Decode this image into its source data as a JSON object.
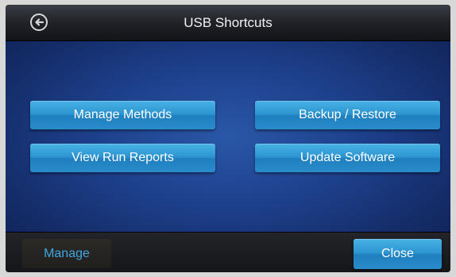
{
  "header": {
    "title": "USB Shortcuts",
    "back_icon": "back-arrow-circle-icon"
  },
  "main": {
    "buttons": [
      {
        "label": "Manage Methods"
      },
      {
        "label": "Backup / Restore"
      },
      {
        "label": "View Run Reports"
      },
      {
        "label": "Update Software"
      }
    ]
  },
  "footer": {
    "manage_label": "Manage",
    "close_label": "Close"
  },
  "colors": {
    "accent_blue": "#2b93cf",
    "panel_blue": "#1d3f8a",
    "manage_text": "#3fa7e3"
  }
}
